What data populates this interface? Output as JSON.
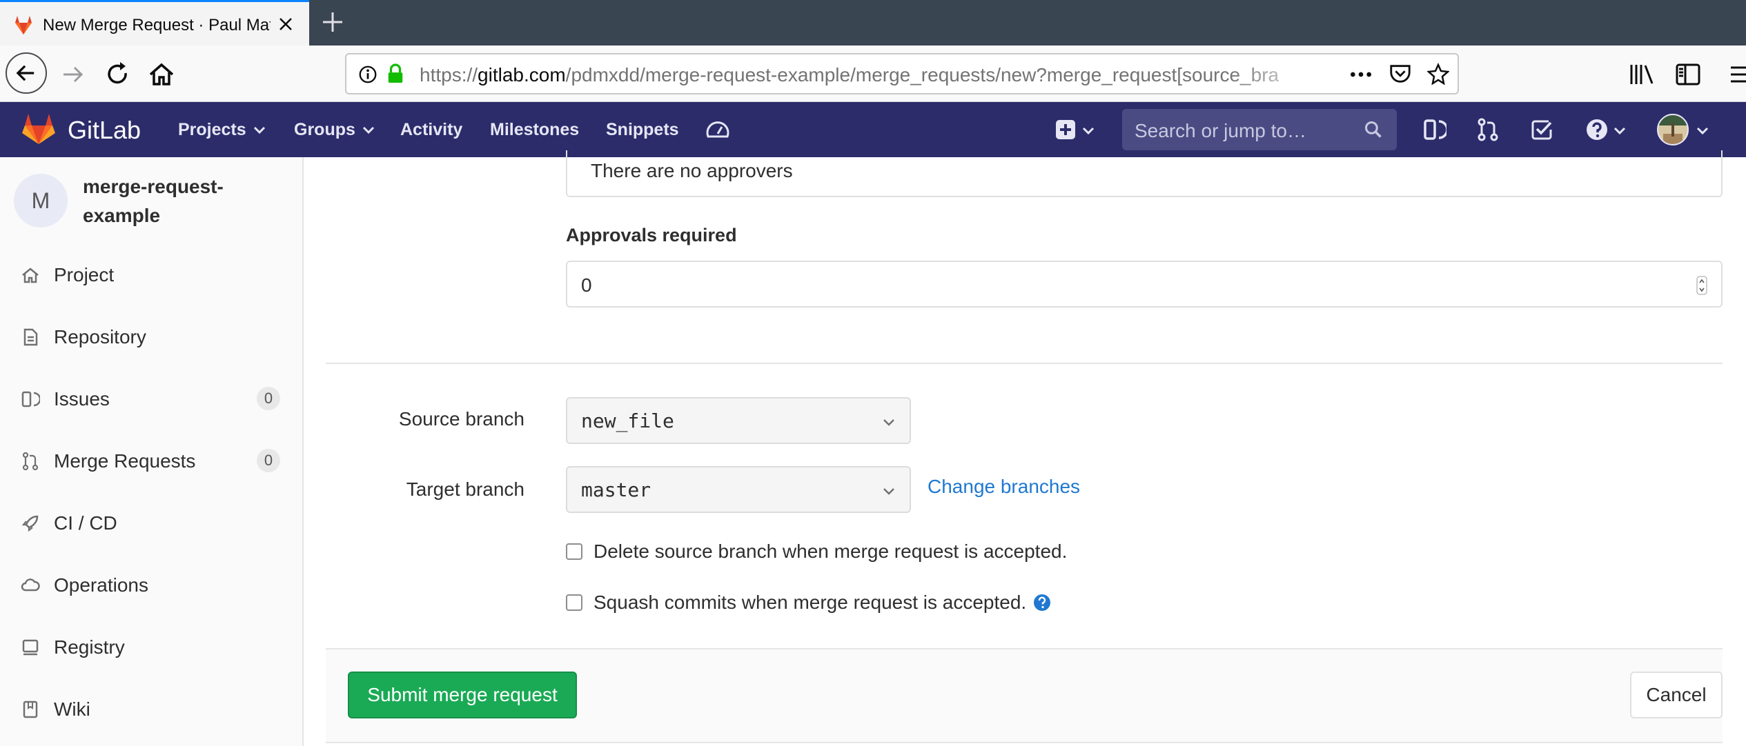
{
  "browser": {
    "tab_title": "New Merge Request · Paul Matt",
    "url_scheme": "https://",
    "url_host": "gitlab.com",
    "url_path": "/pdmxdd/merge-request-example/merge_requests/new?merge_request[source_bra"
  },
  "gitlab": {
    "brand": "GitLab",
    "nav": {
      "projects": "Projects",
      "groups": "Groups",
      "activity": "Activity",
      "milestones": "Milestones",
      "snippets": "Snippets"
    },
    "search_placeholder": "Search or jump to…"
  },
  "sidebar": {
    "avatar_letter": "M",
    "project_name": "merge-request-example",
    "items": [
      {
        "label": "Project",
        "icon": "home-icon"
      },
      {
        "label": "Repository",
        "icon": "doc-icon"
      },
      {
        "label": "Issues",
        "icon": "issues-icon",
        "badge": "0"
      },
      {
        "label": "Merge Requests",
        "icon": "merge-request-icon",
        "badge": "0"
      },
      {
        "label": "CI / CD",
        "icon": "rocket-icon"
      },
      {
        "label": "Operations",
        "icon": "cloud-gear-icon"
      },
      {
        "label": "Registry",
        "icon": "registry-icon"
      },
      {
        "label": "Wiki",
        "icon": "book-icon"
      }
    ]
  },
  "form": {
    "approvers_text": "There are no approvers",
    "approvals_label": "Approvals required",
    "approvals_value": "0",
    "source_label": "Source branch",
    "source_value": "new_file",
    "target_label": "Target branch",
    "target_value": "master",
    "change_branches": "Change branches",
    "delete_source": "Delete source branch when merge request is accepted.",
    "squash_commits": "Squash commits when merge request is accepted.",
    "submit": "Submit merge request",
    "cancel": "Cancel"
  },
  "colors": {
    "header_bg": "#2c2c6b",
    "submit_green": "#1aaa55",
    "link_blue": "#1f78d1"
  }
}
